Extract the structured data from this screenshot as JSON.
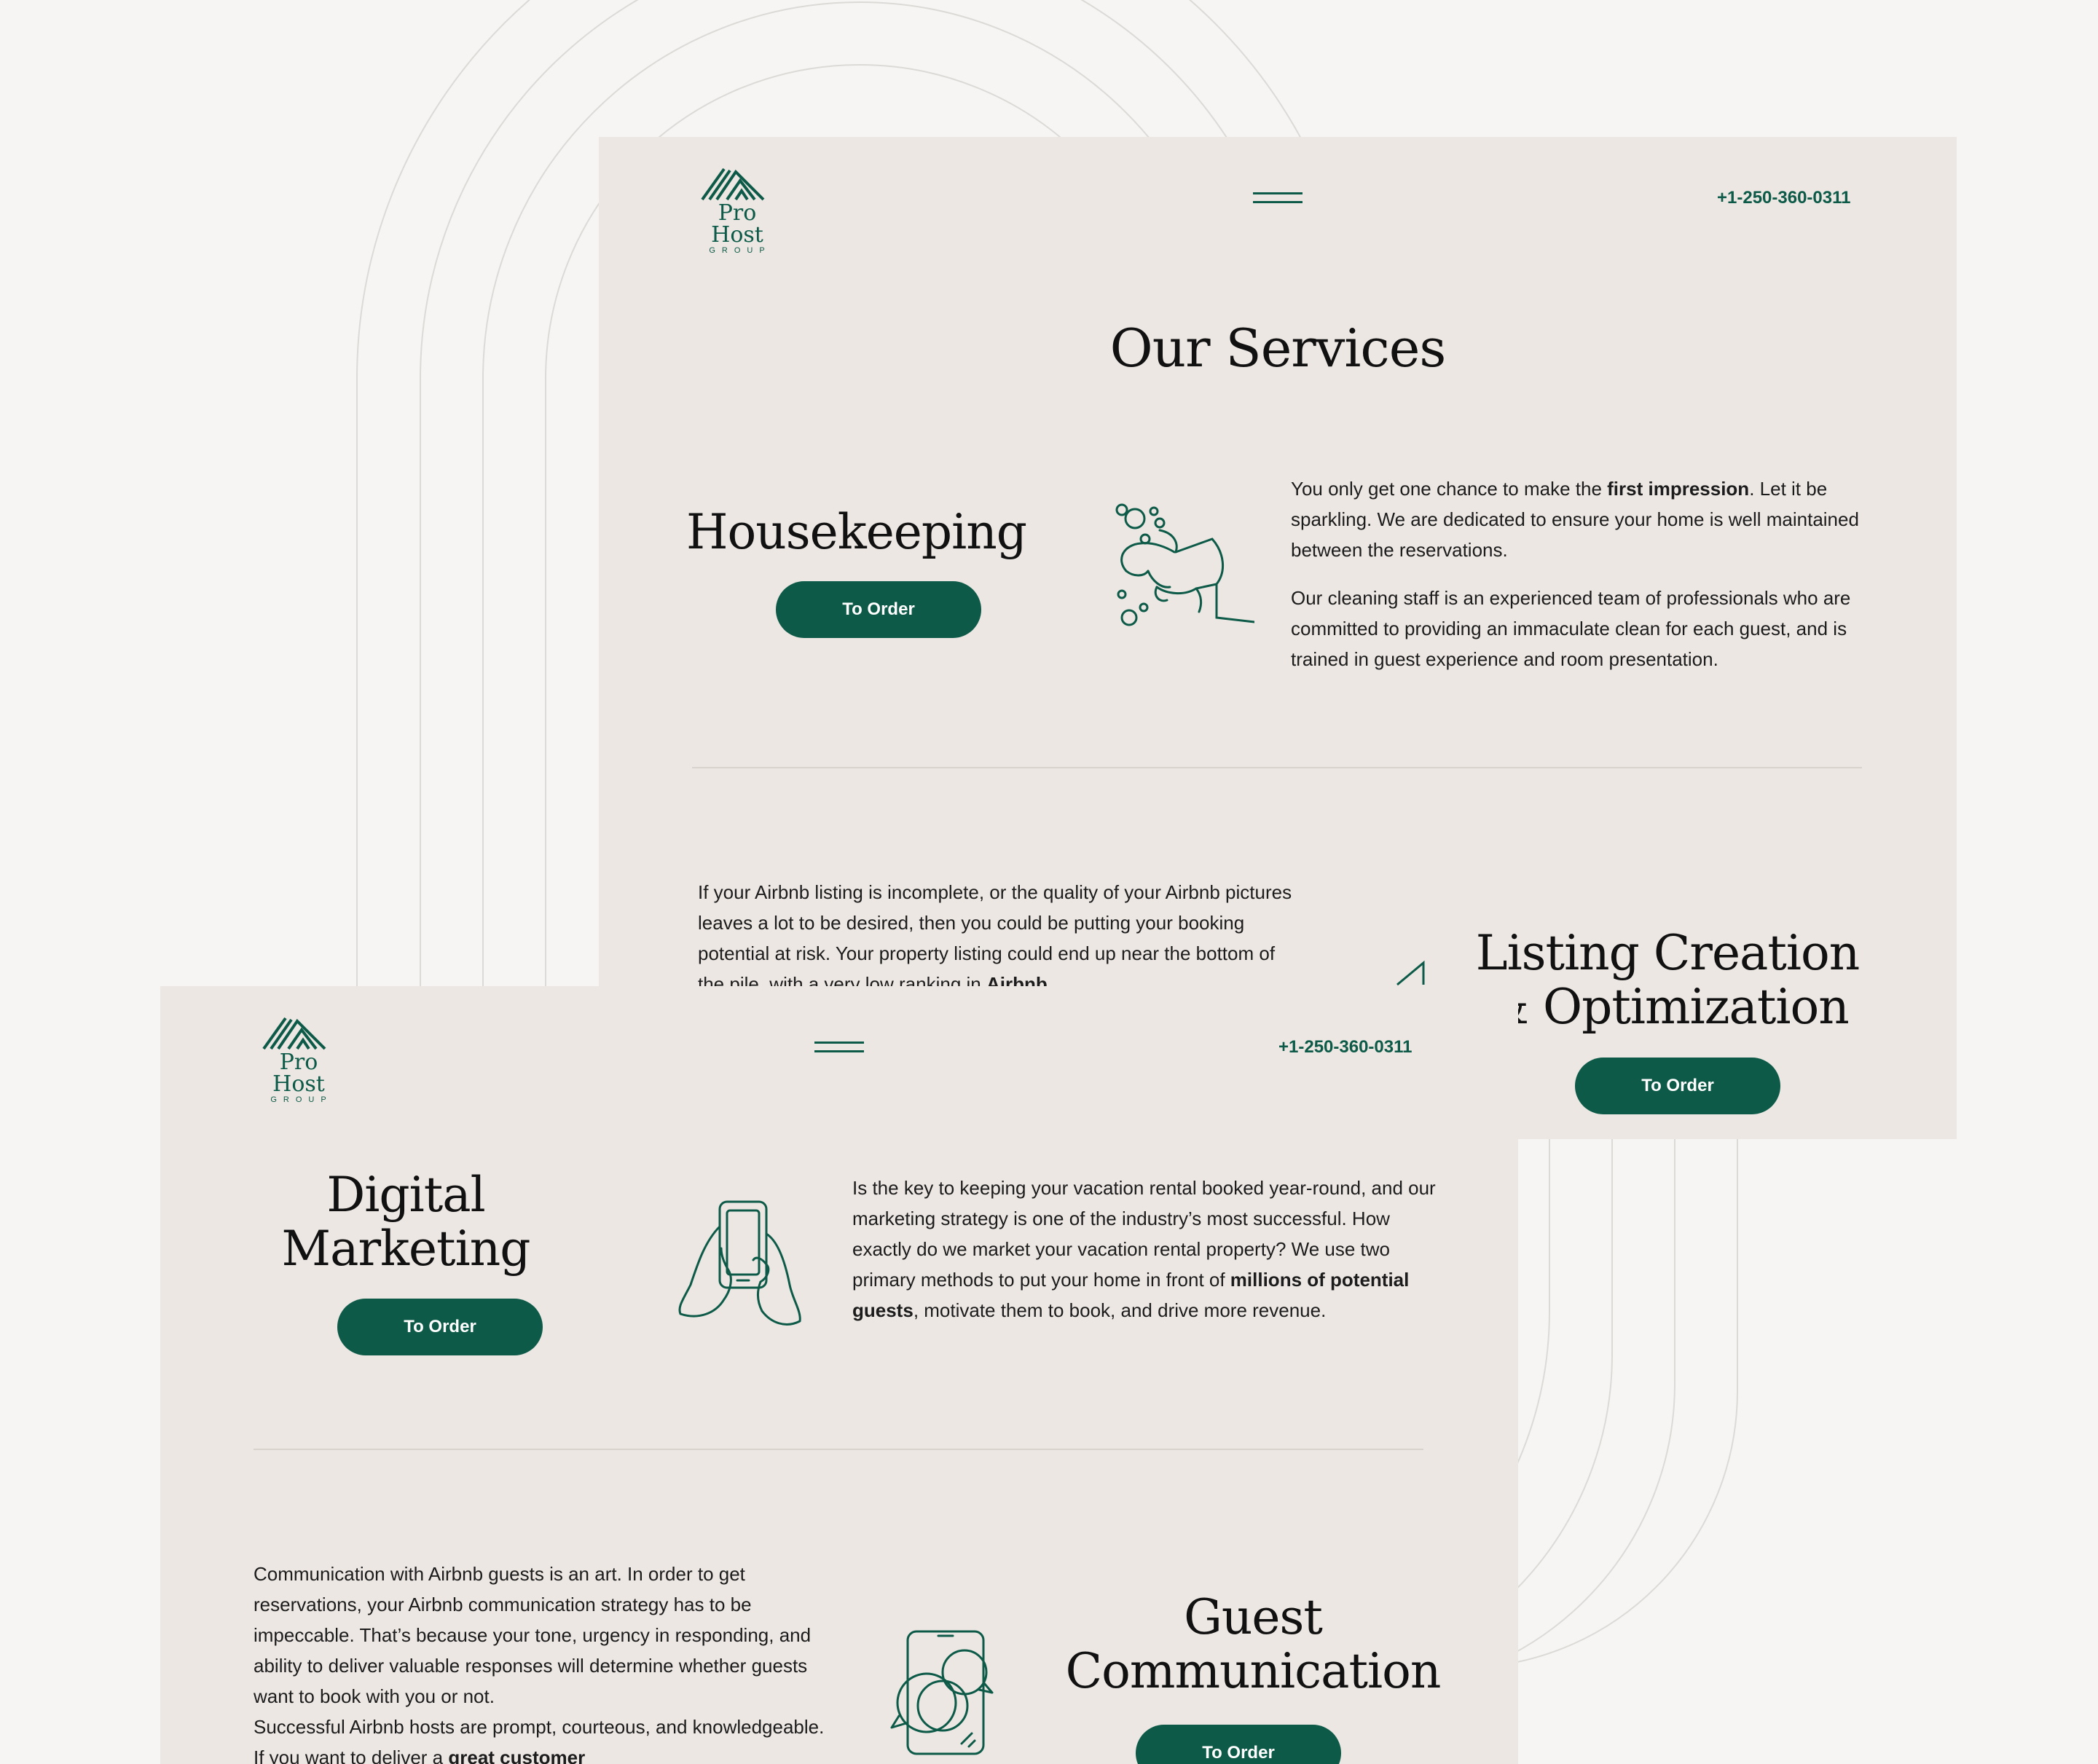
{
  "brand": {
    "name": "Pro Host",
    "sub": "GROUP"
  },
  "nav": {
    "phone": "+1-250-360-0311",
    "menu_icon": "hamburger-menu-icon"
  },
  "page_title": "Our Services",
  "buttons": {
    "order_label": "To Order"
  },
  "services": {
    "housekeeping": {
      "title": "Housekeeping",
      "p1_a": "You only get one chance to make the ",
      "p1_b": "first impression",
      "p1_c": ". Let it be sparkling. We are dedicated to ensure your home is well maintained between the reservations.",
      "p2": "Our cleaning staff is an experienced team of professionals who are committed to providing an immaculate clean for each guest, and is trained in guest experience and room presentation.",
      "icon": "cleaning-hand-icon"
    },
    "listing": {
      "title_line1": "Listing Creation",
      "title_line2": "& Optimization",
      "p1_a": "If your Airbnb listing is incomplete, or the quality of your Airbnb pictures leaves a lot to be desired, then you could be putting your booking potential at risk. Your property listing could end up near the bottom of the pile, with a very low ranking in ",
      "p1_b": "Airbnb",
      "icon": "listing-icon"
    },
    "marketing": {
      "title_line1": "Digital",
      "title_line2": "Marketing",
      "p1_a": "Is the key to keeping your vacation rental booked year-round, and our marketing strategy is one of the industry’s most successful. How exactly do we market your vacation rental property? We use two primary methods to put your home in front of ",
      "p1_b": "millions of potential guests",
      "p1_c": ", motivate them to book, and drive more revenue.",
      "icon": "phone-in-hands-icon"
    },
    "communication": {
      "title_line1": "Guest",
      "title_line2": "Communication",
      "p1": "Communication with Airbnb guests is an art. In order to get reservations, your Airbnb communication strategy has to be impeccable. That’s because your tone, urgency in responding, and ability to deliver valuable responses will determine whether guests want to book with you or not.",
      "p2_a": "Successful Airbnb hosts are prompt, courteous, and knowledgeable. If you want to deliver a ",
      "p2_b": "great customer",
      "icon": "chat-bubbles-phone-icon"
    }
  },
  "colors": {
    "accent": "#0c5a47",
    "panel": "#ece7e3",
    "page": "#f6f5f3"
  }
}
